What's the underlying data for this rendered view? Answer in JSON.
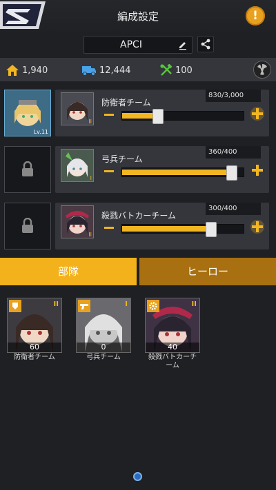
{
  "header": {
    "title": "編成設定",
    "alert_symbol": "!"
  },
  "deck": {
    "name": "APCI"
  },
  "resources": [
    {
      "icon": "house-icon",
      "value": "1,940"
    },
    {
      "icon": "truck-icon",
      "value": "12,444"
    },
    {
      "icon": "wrench-hammer-icon",
      "value": "100"
    }
  ],
  "slots": [
    {
      "active": true,
      "level": "Lv.11"
    },
    {
      "active": false
    },
    {
      "active": false
    }
  ],
  "teams": [
    {
      "name": "防衛者チーム",
      "count": "830/3,000",
      "level": 0.29,
      "rank": "II"
    },
    {
      "name": "弓兵チーム",
      "count": "360/400",
      "level": 0.9,
      "rank": "I"
    },
    {
      "name": "殺戮バトカーチーム",
      "count": "300/400",
      "level": 0.73,
      "rank": "II"
    }
  ],
  "tabs": {
    "squad": "部隊",
    "hero": "ヒーロー"
  },
  "heroes": [
    {
      "name": "防衛者チーム",
      "value": "60",
      "rank": "II",
      "icon": "shield-icon"
    },
    {
      "name": "弓兵チーム",
      "value": "0",
      "rank": "I",
      "icon": "gun-icon"
    },
    {
      "name": "殺戮バトカーチーム",
      "value": "40",
      "rank": "II",
      "icon": "gear-icon"
    }
  ],
  "colors": {
    "accent": "#f3b21b",
    "accent_dark": "#a87010",
    "background": "#1f2024",
    "panel": "#34363c"
  }
}
